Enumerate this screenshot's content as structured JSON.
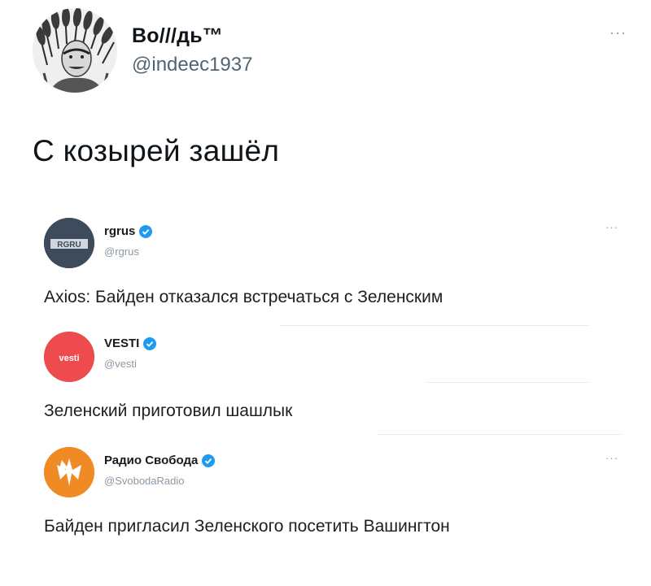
{
  "tweet": {
    "author_name": "Во///дь™",
    "author_handle": "@indeec1937",
    "more": "···",
    "text": "С козырей зашёл"
  },
  "embedded": [
    {
      "avatar_text": "RGRU",
      "name": "rgrus",
      "handle": "@rgrus",
      "more": "···",
      "text": "Axios: Байден отказался встречаться с Зеленским",
      "avatar_color": "#3a4a5c"
    },
    {
      "avatar_text": "vesti",
      "name": "VESTI",
      "handle": "@vesti",
      "text": "Зеленский приготовил шашлык",
      "avatar_color": "#ee4b4f"
    },
    {
      "name": "Радио Свобода",
      "handle": "@SvobodaRadio",
      "more": "···",
      "text": "Байден пригласил Зеленского посетить Вашингтон",
      "avatar_color": "#f08a24"
    }
  ],
  "icons": {
    "verified_color": "#1d9bf0"
  }
}
